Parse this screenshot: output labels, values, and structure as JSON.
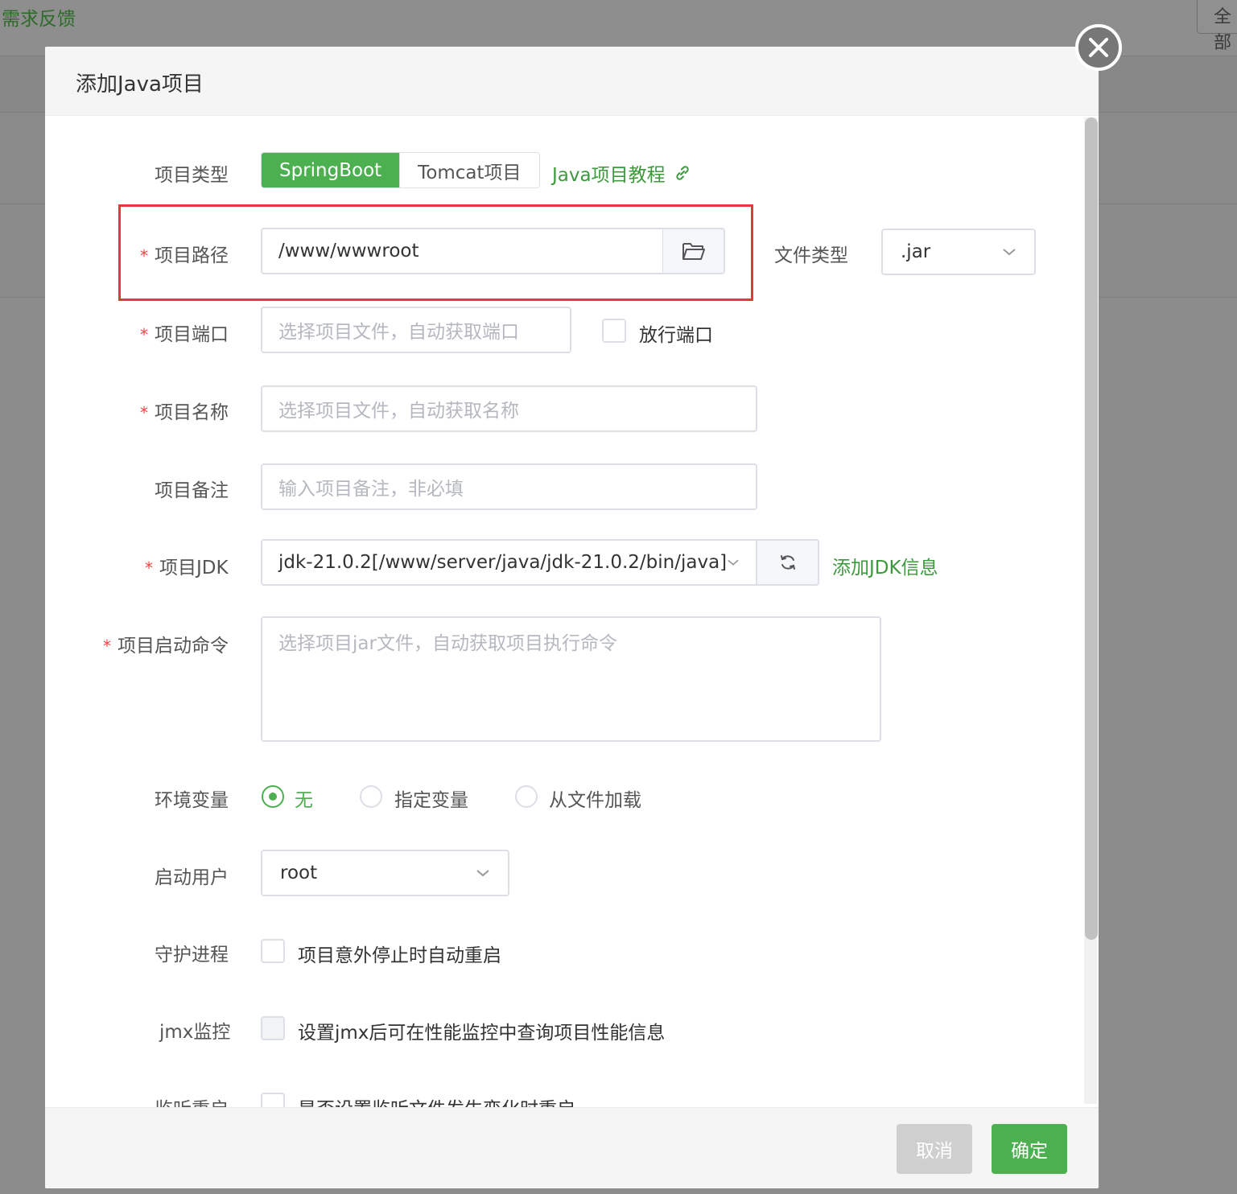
{
  "background": {
    "feedback_link": "需求反馈",
    "top_right_button": "全部"
  },
  "modal": {
    "title": "添加Java项目",
    "project_type": {
      "label": "项目类型",
      "options": [
        "SpringBoot",
        "Tomcat项目"
      ],
      "selected": "SpringBoot",
      "tutorial_link": "Java项目教程"
    },
    "project_path": {
      "label": "项目路径",
      "value": "/www/wwwroot"
    },
    "file_type": {
      "label": "文件类型",
      "value": ".jar"
    },
    "project_port": {
      "label": "项目端口",
      "placeholder": "选择项目文件，自动获取端口",
      "open_port_label": "放行端口"
    },
    "project_name": {
      "label": "项目名称",
      "placeholder": "选择项目文件，自动获取名称"
    },
    "project_remark": {
      "label": "项目备注",
      "placeholder": "输入项目备注，非必填"
    },
    "project_jdk": {
      "label": "项目JDK",
      "value": "jdk-21.0.2[/www/server/java/jdk-21.0.2/bin/java]",
      "add_link": "添加JDK信息"
    },
    "start_command": {
      "label": "项目启动命令",
      "placeholder": "选择项目jar文件，自动获取项目执行命令"
    },
    "env_vars": {
      "label": "环境变量",
      "options": [
        "无",
        "指定变量",
        "从文件加载"
      ],
      "selected": "无"
    },
    "start_user": {
      "label": "启动用户",
      "value": "root"
    },
    "daemon": {
      "label": "守护进程",
      "text": "项目意外停止时自动重启"
    },
    "jmx": {
      "label": "jmx监控",
      "text": "设置jmx后可在性能监控中查询项目性能信息"
    },
    "watch_restart": {
      "label": "监听重启",
      "text": "是否设置监听文件发生变化时重启"
    },
    "footer": {
      "cancel": "取消",
      "confirm": "确定"
    }
  },
  "colors": {
    "accent": "#4caf50",
    "required": "#ef4444",
    "highlight_box": "#e53935"
  }
}
